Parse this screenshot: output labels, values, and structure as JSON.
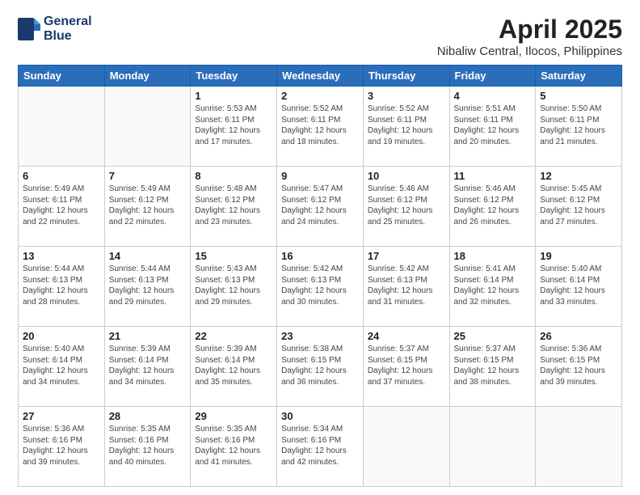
{
  "header": {
    "logo_line1": "General",
    "logo_line2": "Blue",
    "title": "April 2025",
    "subtitle": "Nibaliw Central, Ilocos, Philippines"
  },
  "days_of_week": [
    "Sunday",
    "Monday",
    "Tuesday",
    "Wednesday",
    "Thursday",
    "Friday",
    "Saturday"
  ],
  "weeks": [
    [
      {
        "day": "",
        "info": ""
      },
      {
        "day": "",
        "info": ""
      },
      {
        "day": "1",
        "info": "Sunrise: 5:53 AM\nSunset: 6:11 PM\nDaylight: 12 hours\nand 17 minutes."
      },
      {
        "day": "2",
        "info": "Sunrise: 5:52 AM\nSunset: 6:11 PM\nDaylight: 12 hours\nand 18 minutes."
      },
      {
        "day": "3",
        "info": "Sunrise: 5:52 AM\nSunset: 6:11 PM\nDaylight: 12 hours\nand 19 minutes."
      },
      {
        "day": "4",
        "info": "Sunrise: 5:51 AM\nSunset: 6:11 PM\nDaylight: 12 hours\nand 20 minutes."
      },
      {
        "day": "5",
        "info": "Sunrise: 5:50 AM\nSunset: 6:11 PM\nDaylight: 12 hours\nand 21 minutes."
      }
    ],
    [
      {
        "day": "6",
        "info": "Sunrise: 5:49 AM\nSunset: 6:11 PM\nDaylight: 12 hours\nand 22 minutes."
      },
      {
        "day": "7",
        "info": "Sunrise: 5:49 AM\nSunset: 6:12 PM\nDaylight: 12 hours\nand 22 minutes."
      },
      {
        "day": "8",
        "info": "Sunrise: 5:48 AM\nSunset: 6:12 PM\nDaylight: 12 hours\nand 23 minutes."
      },
      {
        "day": "9",
        "info": "Sunrise: 5:47 AM\nSunset: 6:12 PM\nDaylight: 12 hours\nand 24 minutes."
      },
      {
        "day": "10",
        "info": "Sunrise: 5:46 AM\nSunset: 6:12 PM\nDaylight: 12 hours\nand 25 minutes."
      },
      {
        "day": "11",
        "info": "Sunrise: 5:46 AM\nSunset: 6:12 PM\nDaylight: 12 hours\nand 26 minutes."
      },
      {
        "day": "12",
        "info": "Sunrise: 5:45 AM\nSunset: 6:12 PM\nDaylight: 12 hours\nand 27 minutes."
      }
    ],
    [
      {
        "day": "13",
        "info": "Sunrise: 5:44 AM\nSunset: 6:13 PM\nDaylight: 12 hours\nand 28 minutes."
      },
      {
        "day": "14",
        "info": "Sunrise: 5:44 AM\nSunset: 6:13 PM\nDaylight: 12 hours\nand 29 minutes."
      },
      {
        "day": "15",
        "info": "Sunrise: 5:43 AM\nSunset: 6:13 PM\nDaylight: 12 hours\nand 29 minutes."
      },
      {
        "day": "16",
        "info": "Sunrise: 5:42 AM\nSunset: 6:13 PM\nDaylight: 12 hours\nand 30 minutes."
      },
      {
        "day": "17",
        "info": "Sunrise: 5:42 AM\nSunset: 6:13 PM\nDaylight: 12 hours\nand 31 minutes."
      },
      {
        "day": "18",
        "info": "Sunrise: 5:41 AM\nSunset: 6:14 PM\nDaylight: 12 hours\nand 32 minutes."
      },
      {
        "day": "19",
        "info": "Sunrise: 5:40 AM\nSunset: 6:14 PM\nDaylight: 12 hours\nand 33 minutes."
      }
    ],
    [
      {
        "day": "20",
        "info": "Sunrise: 5:40 AM\nSunset: 6:14 PM\nDaylight: 12 hours\nand 34 minutes."
      },
      {
        "day": "21",
        "info": "Sunrise: 5:39 AM\nSunset: 6:14 PM\nDaylight: 12 hours\nand 34 minutes."
      },
      {
        "day": "22",
        "info": "Sunrise: 5:39 AM\nSunset: 6:14 PM\nDaylight: 12 hours\nand 35 minutes."
      },
      {
        "day": "23",
        "info": "Sunrise: 5:38 AM\nSunset: 6:15 PM\nDaylight: 12 hours\nand 36 minutes."
      },
      {
        "day": "24",
        "info": "Sunrise: 5:37 AM\nSunset: 6:15 PM\nDaylight: 12 hours\nand 37 minutes."
      },
      {
        "day": "25",
        "info": "Sunrise: 5:37 AM\nSunset: 6:15 PM\nDaylight: 12 hours\nand 38 minutes."
      },
      {
        "day": "26",
        "info": "Sunrise: 5:36 AM\nSunset: 6:15 PM\nDaylight: 12 hours\nand 39 minutes."
      }
    ],
    [
      {
        "day": "27",
        "info": "Sunrise: 5:36 AM\nSunset: 6:16 PM\nDaylight: 12 hours\nand 39 minutes."
      },
      {
        "day": "28",
        "info": "Sunrise: 5:35 AM\nSunset: 6:16 PM\nDaylight: 12 hours\nand 40 minutes."
      },
      {
        "day": "29",
        "info": "Sunrise: 5:35 AM\nSunset: 6:16 PM\nDaylight: 12 hours\nand 41 minutes."
      },
      {
        "day": "30",
        "info": "Sunrise: 5:34 AM\nSunset: 6:16 PM\nDaylight: 12 hours\nand 42 minutes."
      },
      {
        "day": "",
        "info": ""
      },
      {
        "day": "",
        "info": ""
      },
      {
        "day": "",
        "info": ""
      }
    ]
  ]
}
